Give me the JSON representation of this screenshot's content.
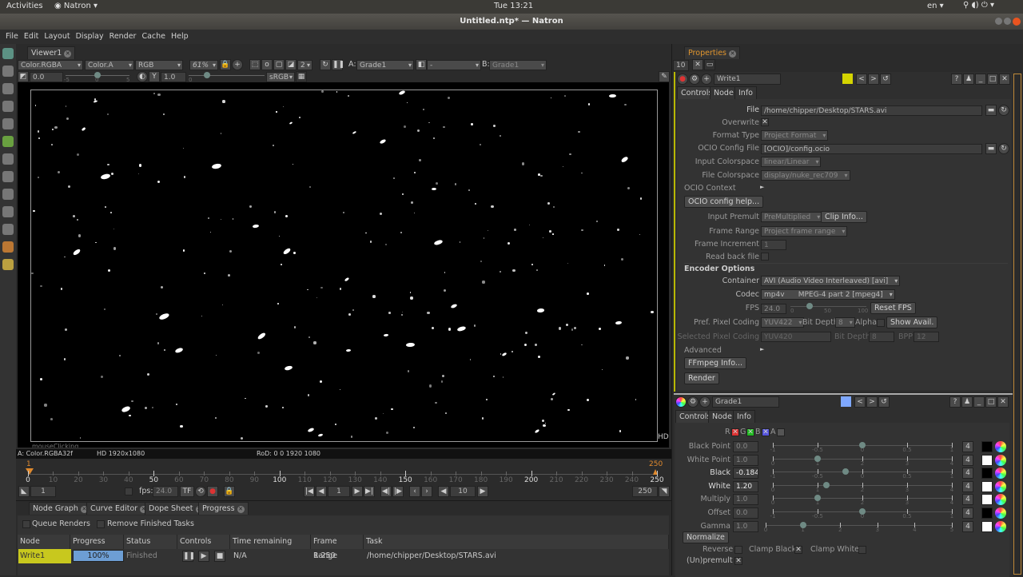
{
  "system": {
    "activities": "Activities",
    "app": "Natron",
    "clock": "Tue 13:21",
    "lang": "en"
  },
  "window": {
    "title": "Untitled.ntp* — Natron"
  },
  "menu": [
    "File",
    "Edit",
    "Layout",
    "Display",
    "Render",
    "Cache",
    "Help"
  ],
  "viewer": {
    "tab": "Viewer1",
    "layer": "Color.RGBA",
    "alpha": "Color.A",
    "channels": "RGB",
    "zoom": "61%",
    "mip": "2",
    "input_a_label": "A:",
    "input_a": "Grade1",
    "op": "-",
    "input_b_label": "B:",
    "input_b": "Grade1",
    "gain": "0.0",
    "gain_ticks": [
      "-5",
      "0",
      "5"
    ],
    "gamma_label": "Y",
    "gamma": "1.0",
    "gamma_ticks": [
      "0"
    ],
    "colorspace": "sRGB",
    "info_layer": "A: Color.RGBA32f",
    "info_format": "HD 1920x1080",
    "info_rod": "RoD: 0 0 1920 1080",
    "hd_label": "HD",
    "overlay_text": "mouseClicking"
  },
  "timeline": {
    "start_marker": "1",
    "end_marker": "250",
    "ticks": [
      0,
      10,
      20,
      30,
      40,
      50,
      60,
      70,
      80,
      90,
      100,
      110,
      120,
      130,
      140,
      150,
      160,
      170,
      180,
      190,
      200,
      210,
      220,
      230,
      240,
      250
    ],
    "range": [
      0,
      250
    ],
    "first_frame": "1",
    "fps_label": "fps:",
    "fps": "24.0",
    "tf": "TF",
    "current_frame": "1",
    "increment": "10",
    "last_frame": "250"
  },
  "bottom_tabs": [
    "Node Graph",
    "Curve Editor",
    "Dope Sheet",
    "Progress"
  ],
  "progress": {
    "queue_renders": "Queue Renders",
    "remove_finished": "Remove Finished Tasks",
    "columns": [
      "Node",
      "Progress",
      "Status",
      "Controls",
      "Time remaining",
      "Frame Range",
      "Task"
    ],
    "rows": [
      {
        "node": "Write1",
        "progress": "100%",
        "progress_value": 1.0,
        "status": "Finished",
        "time_remaining": "N/A",
        "frame_range": "1-250",
        "task": "/home/chipper/Desktop/STARS.avi"
      }
    ],
    "node_color": "#c8c81e",
    "bar_color": "#6d9ed4"
  },
  "properties": {
    "tab": "Properties",
    "max_panels": "10",
    "write": {
      "name": "Write1",
      "color": "#d4d400",
      "tabs": [
        "Controls",
        "Node",
        "Info"
      ],
      "file_label": "File",
      "file": "/home/chipper/Desktop/STARS.avi",
      "overwrite_label": "Overwrite",
      "overwrite": true,
      "format_type_label": "Format Type",
      "format_type": "Project Format",
      "ocio_file_label": "OCIO Config File",
      "ocio_file": "[OCIO]/config.ocio",
      "input_cs_label": "Input Colorspace",
      "input_cs": "linear/Linear",
      "file_cs_label": "File Colorspace",
      "file_cs": "display/nuke_rec709",
      "ocio_context": "OCIO Context",
      "ocio_help": "OCIO config help...",
      "premult_label": "Input Premult",
      "premult": "PreMultiplied",
      "clip_info": "Clip Info...",
      "frame_range_label": "Frame Range",
      "frame_range": "Project frame range",
      "frame_inc_label": "Frame Increment",
      "frame_inc": "1",
      "read_back_label": "Read back file",
      "encoder_options": "Encoder Options",
      "container_label": "Container",
      "container": "AVI (Audio Video Interleaved) [avi]",
      "codec_label": "Codec",
      "codec": "mp4v      MPEG-4 part 2 [mpeg4]",
      "fps_label": "FPS",
      "fps": "24.0",
      "fps_ticks": [
        "0",
        "50",
        "100"
      ],
      "reset_fps": "Reset FPS",
      "pref_pix_label": "Pref. Pixel Coding",
      "pref_pix": "YUV422",
      "bit_depth_label": "Bit Depth",
      "bit_depth": "8",
      "alpha_label": "Alpha",
      "show_avail": "Show Avail.",
      "sel_pix_label": "Selected Pixel Coding",
      "sel_pix": "YUV420",
      "sel_bit_depth": "8",
      "bpp_label": "BPP",
      "bpp": "12",
      "advanced": "Advanced",
      "ffmpeg_info": "FFmpeg Info...",
      "render": "Render"
    },
    "grade": {
      "name": "Grade1",
      "color": "#7fa8ff",
      "tabs": [
        "Controls",
        "Node",
        "Info"
      ],
      "channels": [
        {
          "label": "R",
          "color": "#d33",
          "on": true
        },
        {
          "label": "G",
          "color": "#2b2",
          "on": true
        },
        {
          "label": "B",
          "color": "#55d",
          "on": true
        },
        {
          "label": "A",
          "color": "#555",
          "on": false
        }
      ],
      "params": [
        {
          "label": "Black Point",
          "value": "0.0",
          "v": 0,
          "min": -1,
          "max": 1,
          "ticks": [
            "-1",
            "-0.5",
            "0",
            "0.5",
            "1"
          ],
          "swatch": "#000",
          "bright": false
        },
        {
          "label": "White Point",
          "value": "1.0",
          "v": 1,
          "min": 0,
          "max": 4,
          "ticks": [
            "0",
            "1",
            "2",
            "3",
            "4"
          ],
          "swatch": "#fff",
          "bright": false
        },
        {
          "label": "Black",
          "value": "-0.1840",
          "v": -0.184,
          "min": -1,
          "max": 1,
          "ticks": [
            "-1",
            "-0.5",
            "0",
            "0.5",
            "1"
          ],
          "swatch": "#000",
          "bright": true
        },
        {
          "label": "White",
          "value": "1.20",
          "v": 1.2,
          "min": 0,
          "max": 4,
          "ticks": [
            "0",
            "1",
            "2",
            "3",
            "4"
          ],
          "swatch": "#fff",
          "bright": true
        },
        {
          "label": "Multiply",
          "value": "1.0",
          "v": 1,
          "min": 0,
          "max": 4,
          "ticks": [
            "0",
            "1",
            "2",
            "3",
            "4"
          ],
          "swatch": "#fff",
          "bright": false
        },
        {
          "label": "Offset",
          "value": "0.0",
          "v": 0,
          "min": -1,
          "max": 1,
          "ticks": [
            "-1",
            "-0.5",
            "0",
            "0.5",
            "1"
          ],
          "swatch": "#000",
          "bright": false
        },
        {
          "label": "Gamma",
          "value": "1.0",
          "v": 1,
          "min": 0,
          "max": 5,
          "ticks": [
            "0",
            "1",
            "2",
            "3",
            "4",
            "5"
          ],
          "swatch": "#fff",
          "bright": false
        }
      ],
      "dims": "4",
      "normalize": "Normalize",
      "reverse": "Reverse",
      "clamp_black": "Clamp Black",
      "clamp_white": "Clamp White",
      "unpremult": "(Un)premult"
    }
  }
}
